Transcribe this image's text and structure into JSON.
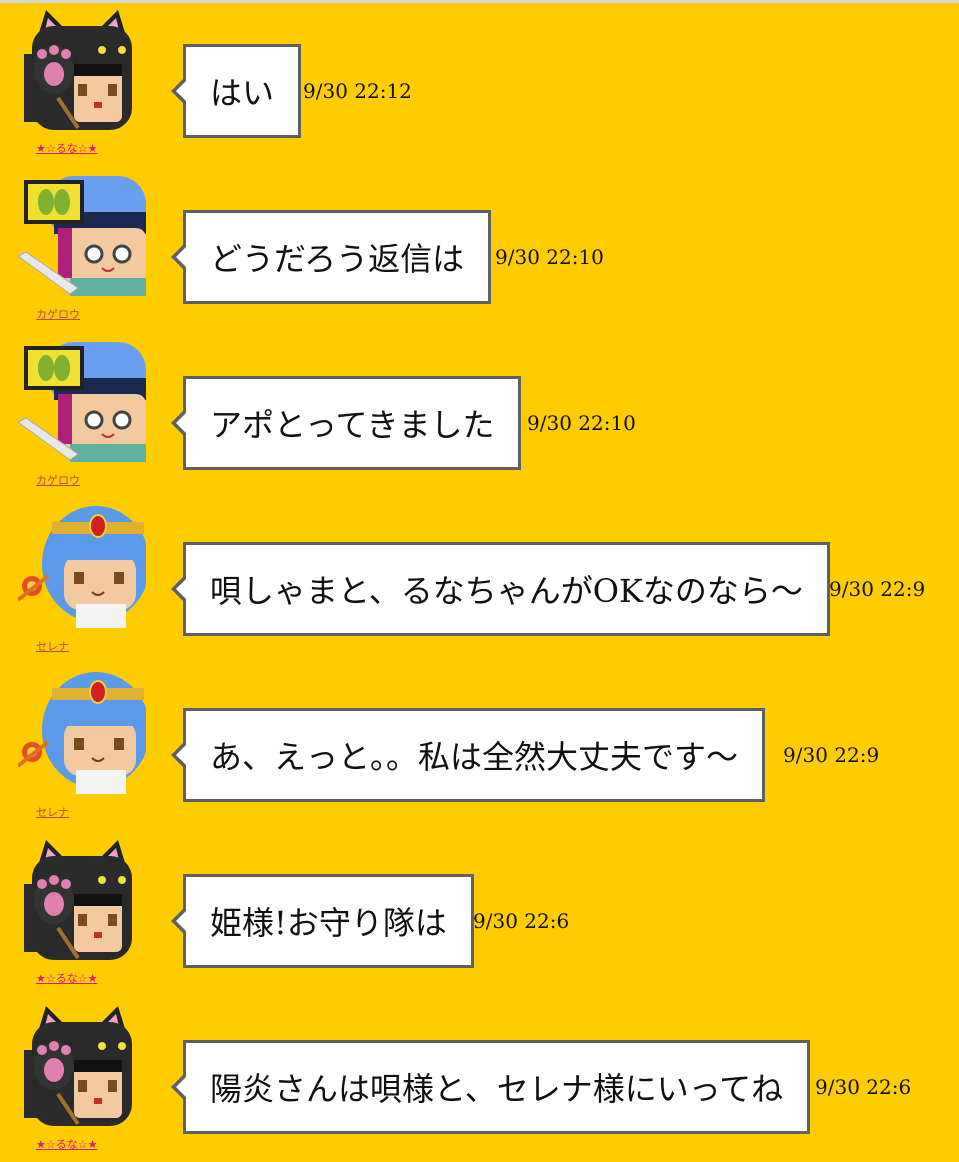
{
  "colors": {
    "background": "#ffcc00",
    "bubble_border": "#606060",
    "luna_name": "#e0197a",
    "other_name": "#c04a3a"
  },
  "messages": [
    {
      "user": "★☆るな☆★",
      "avatar": "cat-girl-avatar",
      "text": "はい",
      "time": "9/30 22:12"
    },
    {
      "user": "カゲロウ",
      "avatar": "ninja-boy-avatar",
      "text": "どうだろう返信は",
      "time": "9/30 22:10"
    },
    {
      "user": "カゲロウ",
      "avatar": "ninja-boy-avatar",
      "text": "アポとってきました",
      "time": "9/30 22:10"
    },
    {
      "user": "セレナ",
      "avatar": "blue-hair-girl-avatar",
      "text": "唄しゃまと、るなちゃんがOKなのなら～",
      "time": "9/30 22:9"
    },
    {
      "user": "セレナ",
      "avatar": "blue-hair-girl-avatar",
      "text": "あ、えっと。。私は全然大丈夫です～",
      "time": "9/30 22:9"
    },
    {
      "user": "★☆るな☆★",
      "avatar": "cat-girl-avatar",
      "text": "姫様!お守り隊は",
      "time": "9/30 22:6"
    },
    {
      "user": "★☆るな☆★",
      "avatar": "cat-girl-avatar",
      "text": "陽炎さんは唄様と、セレナ様にいってね",
      "time": "9/30 22:6"
    }
  ]
}
